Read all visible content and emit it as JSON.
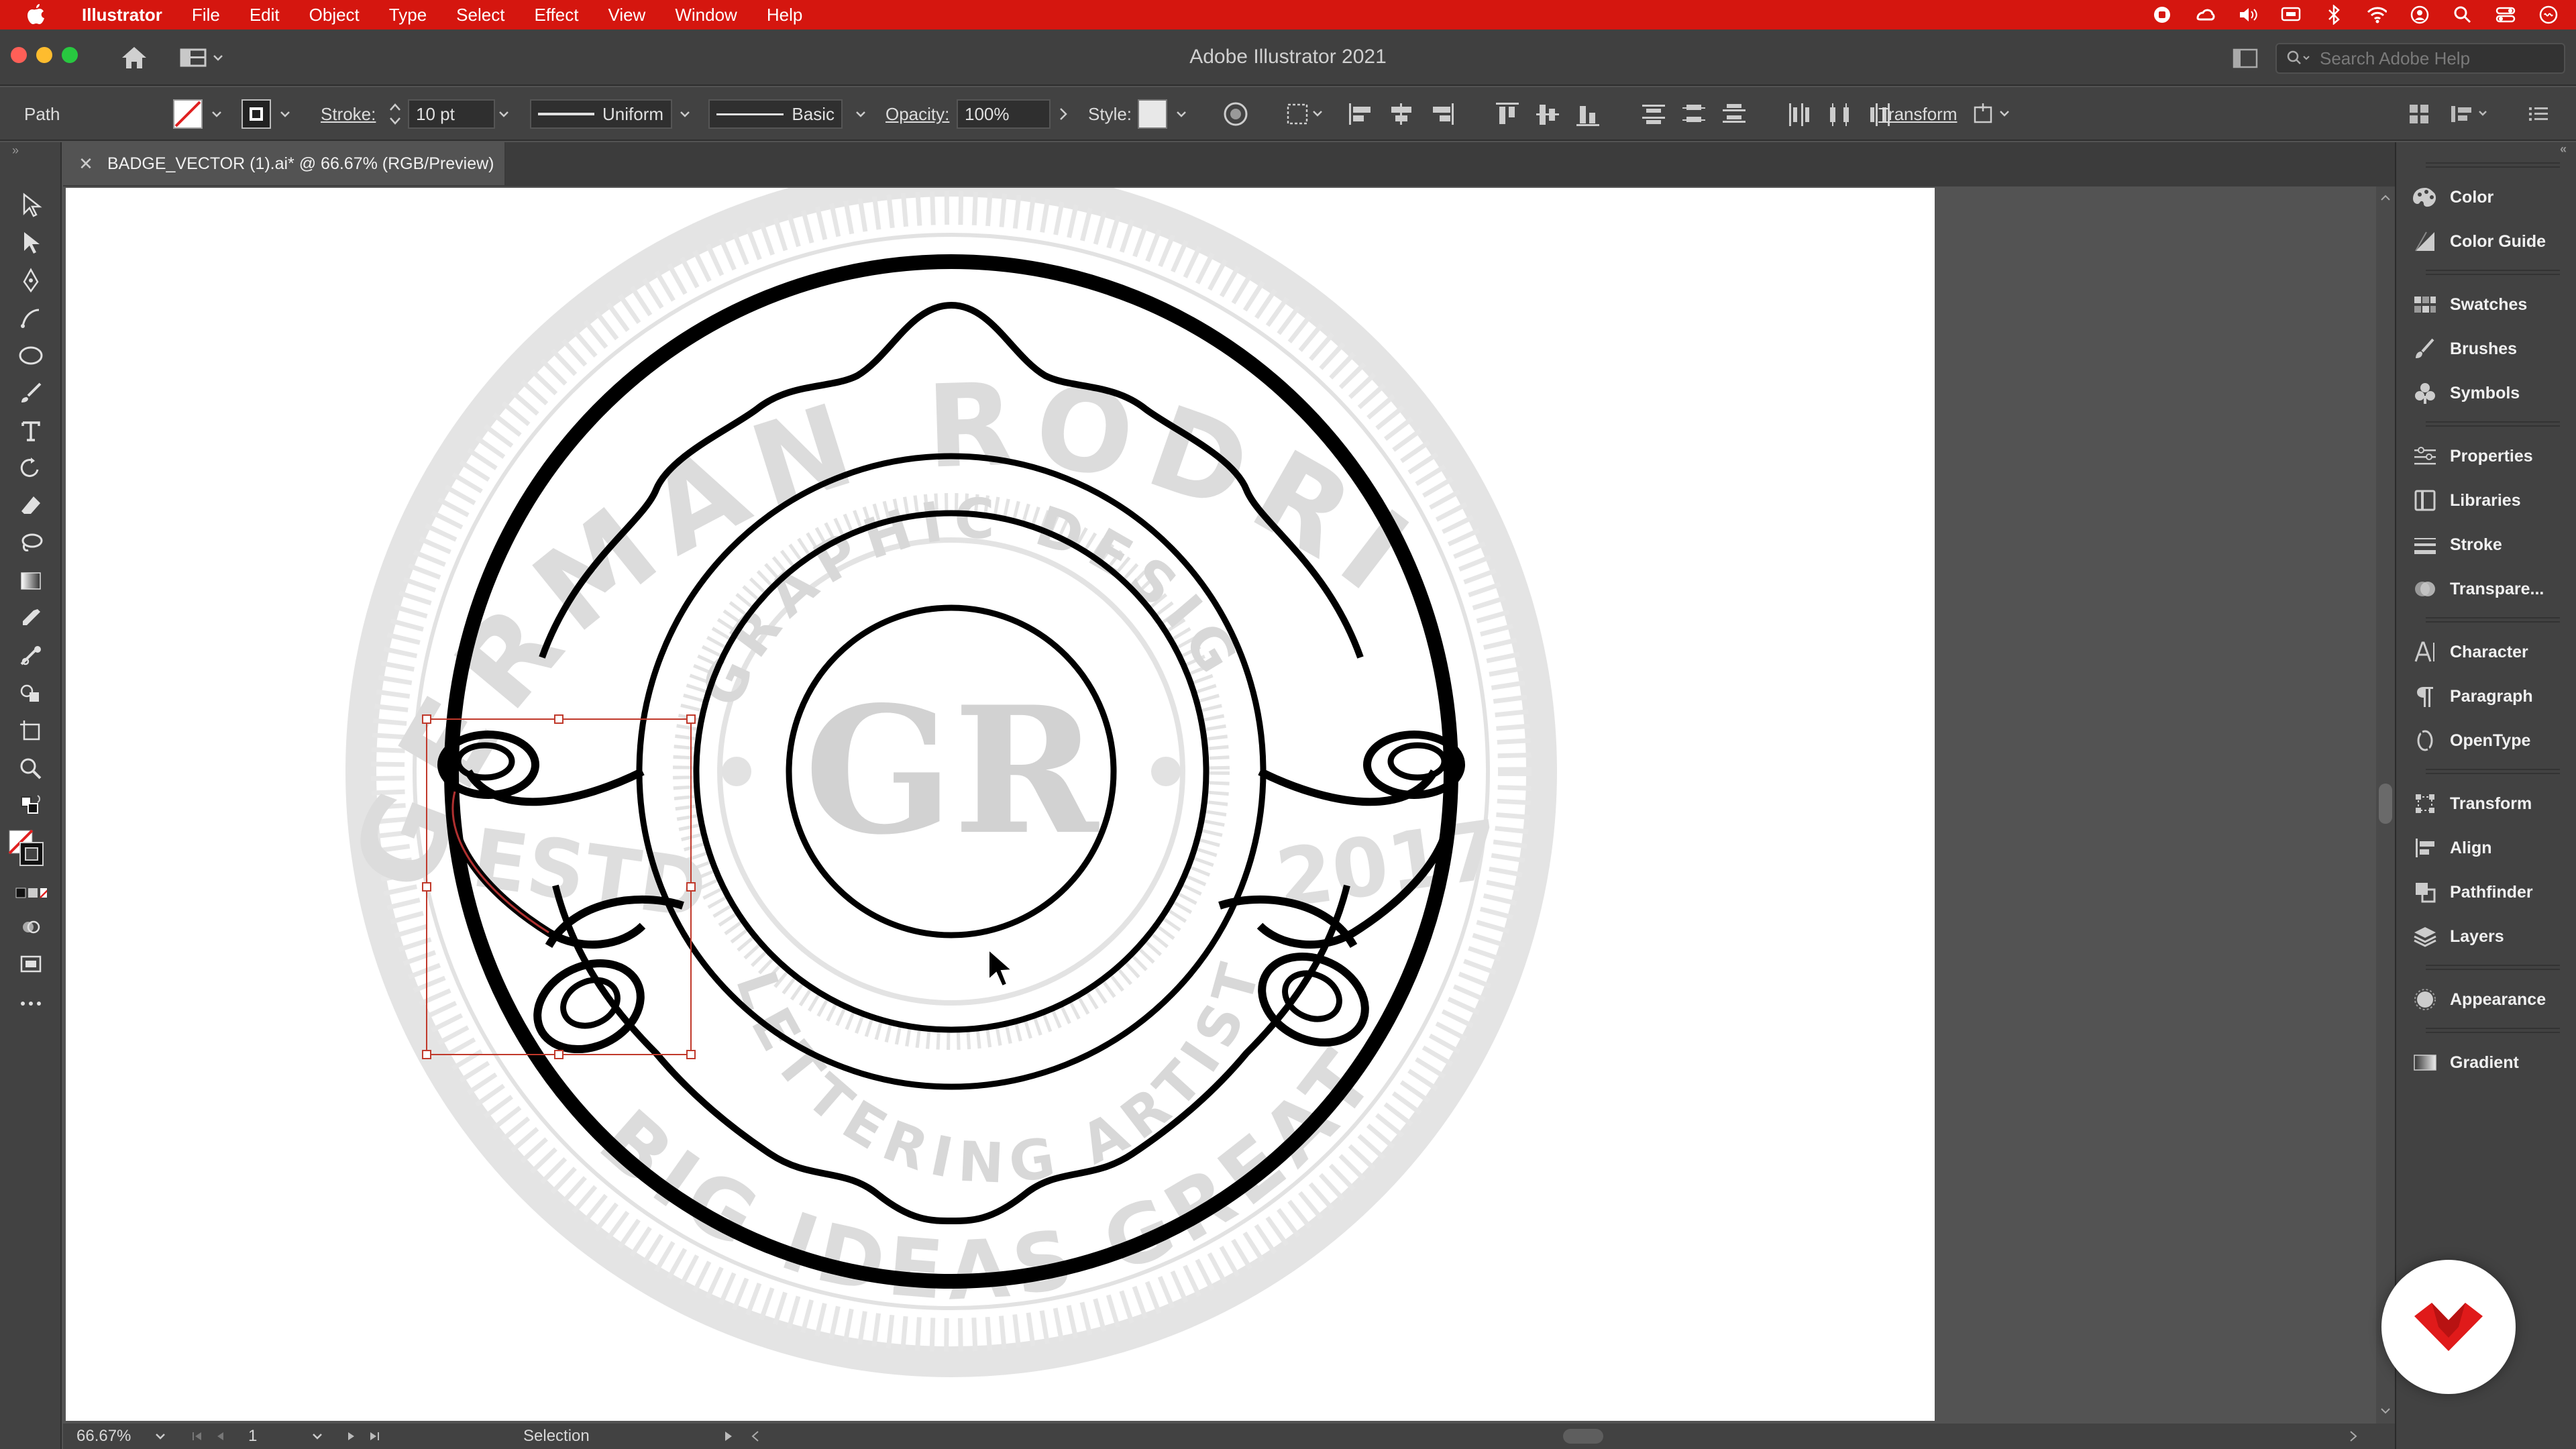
{
  "menubar": {
    "apple_icon": "apple-icon",
    "items": [
      "Illustrator",
      "File",
      "Edit",
      "Object",
      "Type",
      "Select",
      "Effect",
      "View",
      "Window",
      "Help"
    ],
    "status_icons": [
      "record-icon",
      "creative-cloud-icon",
      "volume-icon",
      "display-icon",
      "bluetooth-icon",
      "wifi-icon",
      "user-icon",
      "search-icon",
      "control-center-icon",
      "siri-icon"
    ]
  },
  "titlebar": {
    "title": "Adobe Illustrator 2021",
    "search_placeholder": "Search Adobe Help"
  },
  "controlbar": {
    "selection_type": "Path",
    "stroke_label": "Stroke:",
    "stroke_value": "10 pt",
    "profile": "Uniform",
    "brush": "Basic",
    "opacity_label": "Opacity:",
    "opacity_value": "100%",
    "style_label": "Style:",
    "transform_label": "Transform"
  },
  "document": {
    "tab_title": "BADGE_VECTOR (1).ai* @ 66.67% (RGB/Preview)"
  },
  "artwork": {
    "outer_text": "GERMAN RODRIGUEZ",
    "inner_text_top": "GRAPHIC DESIGNER",
    "inner_text_bottom": "LETTERING ARTIST",
    "left_year": "ESTD",
    "right_year": "2017",
    "bottom_text": "BIG IDEAS GREAT RESULTS",
    "monogram": "GR"
  },
  "statusbar": {
    "zoom": "66.67%",
    "artboard_num": "1",
    "mode": "Selection"
  },
  "dock": {
    "items": [
      {
        "label": "Color",
        "icon": "color-palette-icon"
      },
      {
        "label": "Color Guide",
        "icon": "color-guide-icon"
      },
      {
        "label": "Swatches",
        "icon": "swatches-icon"
      },
      {
        "label": "Brushes",
        "icon": "brushes-icon"
      },
      {
        "label": "Symbols",
        "icon": "symbols-icon"
      },
      {
        "label": "Properties",
        "icon": "properties-icon"
      },
      {
        "label": "Libraries",
        "icon": "libraries-icon"
      },
      {
        "label": "Stroke",
        "icon": "stroke-icon"
      },
      {
        "label": "Transpare...",
        "icon": "transparency-icon"
      },
      {
        "label": "Character",
        "icon": "character-icon"
      },
      {
        "label": "Paragraph",
        "icon": "paragraph-icon"
      },
      {
        "label": "OpenType",
        "icon": "opentype-icon"
      },
      {
        "label": "Transform",
        "icon": "transform-icon"
      },
      {
        "label": "Align",
        "icon": "align-icon"
      },
      {
        "label": "Pathfinder",
        "icon": "pathfinder-icon"
      },
      {
        "label": "Layers",
        "icon": "layers-icon"
      },
      {
        "label": "Appearance",
        "icon": "appearance-icon"
      },
      {
        "label": "Gradient",
        "icon": "gradient-icon"
      }
    ]
  },
  "colors": {
    "menubar_bg": "#d5160f",
    "selection_red": "#c0392b",
    "brand_red": "#e01a1a"
  }
}
